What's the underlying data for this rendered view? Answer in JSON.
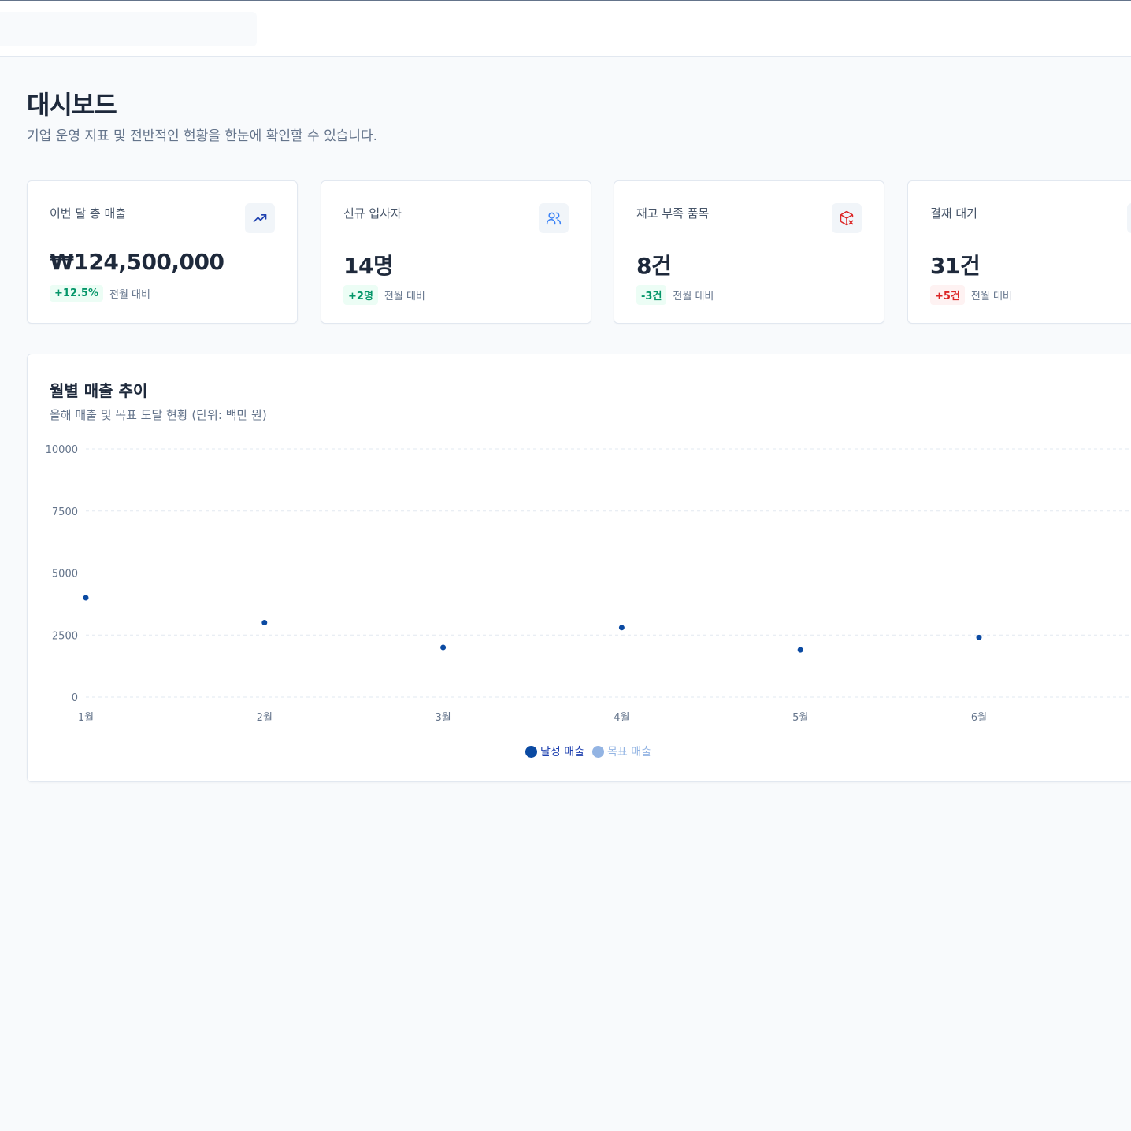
{
  "header": {},
  "page": {
    "title": "대시보드",
    "subtitle": "기업 운영 지표 및 전반적인 현황을 한눈에 확인할 수 있습니다."
  },
  "cards": [
    {
      "label": "이번 달 총 매출",
      "value": "₩124,500,000",
      "change": "+12.5%",
      "compare": "전월 대비",
      "icon": "trending-up-icon",
      "tone": "good"
    },
    {
      "label": "신규 입사자",
      "value": "14명",
      "change": "+2명",
      "compare": "전월 대비",
      "icon": "users-icon",
      "tone": "good"
    },
    {
      "label": "재고 부족 품목",
      "value": "8건",
      "change": "-3건",
      "compare": "전월 대비",
      "icon": "package-x-icon",
      "tone": "good"
    },
    {
      "label": "결재 대기",
      "value": "31건",
      "change": "+5건",
      "compare": "전월 대비",
      "icon": "file-clock-icon",
      "tone": "bad"
    }
  ],
  "colors": {
    "primary": "#1e40af",
    "series_achieved": "#0b4aa2",
    "series_target": "#93b4e3",
    "good_text": "#059669",
    "good_bg": "#ecfdf5",
    "bad_text": "#dc2626",
    "bad_bg": "#fef2f2"
  },
  "chart_data": {
    "type": "scatter",
    "title": "월별 매출 추이",
    "subtitle": "올해 매출 및 목표 도달 현황 (단위: 백만 원)",
    "categories": [
      "1월",
      "2월",
      "3월",
      "4월",
      "5월",
      "6월"
    ],
    "yticks": [
      "0",
      "2500",
      "5000",
      "7500",
      "10000"
    ],
    "ylim": [
      0,
      10000
    ],
    "grid": true,
    "legend_position": "bottom",
    "series": [
      {
        "name": "달성 매출",
        "values": [
          4000,
          3000,
          2000,
          2800,
          1900,
          2400
        ]
      },
      {
        "name": "목표 매출",
        "values": []
      }
    ]
  }
}
